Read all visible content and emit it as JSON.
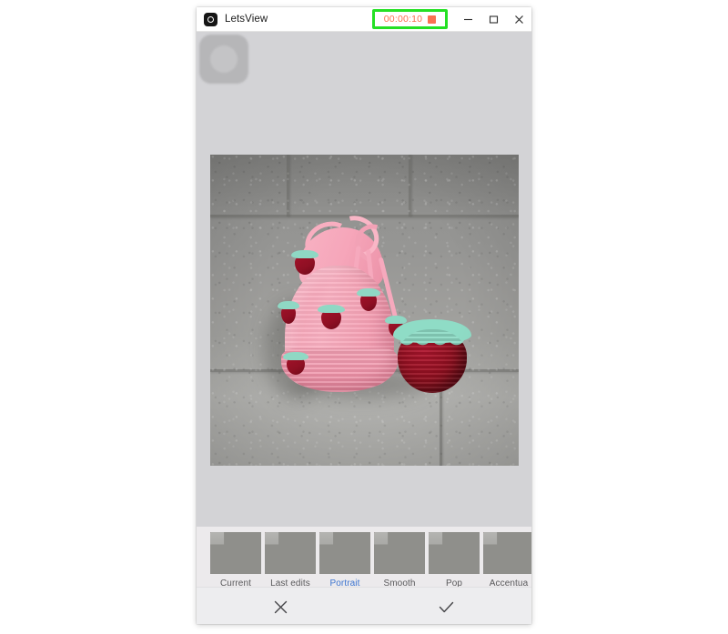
{
  "window": {
    "app_title": "LetsView",
    "logo_icon": "letsview-circle-logo",
    "recording": {
      "timer": "00:00:10",
      "stop_icon": "stop-square-icon",
      "timer_color": "#fc6c4c",
      "highlight_color": "#24e024"
    },
    "controls": {
      "minimize": "minimize-icon",
      "maximize": "maximize-icon",
      "close": "close-icon"
    }
  },
  "mirror": {
    "device_icon": "device-home-button-icon",
    "photo_alt": "crocheted pink strawberry drawstring pouch on gray tile"
  },
  "filters": {
    "items": [
      {
        "label": "Current",
        "selected": false
      },
      {
        "label": "Last edits",
        "selected": false
      },
      {
        "label": "Portrait",
        "selected": true
      },
      {
        "label": "Smooth",
        "selected": false
      },
      {
        "label": "Pop",
        "selected": false
      },
      {
        "label": "Accentua",
        "selected": false
      }
    ],
    "selected_color": "#3b74d0",
    "label_color": "#59595b"
  },
  "actions": {
    "cancel": {
      "icon": "close-x-icon",
      "label": "Cancel"
    },
    "confirm": {
      "icon": "checkmark-icon",
      "label": "Done"
    }
  }
}
